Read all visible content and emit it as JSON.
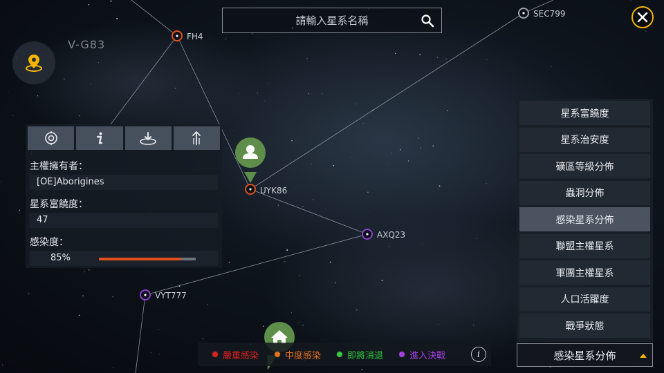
{
  "system": {
    "current_name": "V-G83"
  },
  "search": {
    "placeholder": "請輸入星系名稱"
  },
  "nodes": [
    {
      "id": "FH4",
      "label": "FH4",
      "color": "#e2501c"
    },
    {
      "id": "SEC799",
      "label": "SEC799",
      "color": "#9aa3ad"
    },
    {
      "id": "UYK86",
      "label": "UYK86",
      "color": "#e2501c"
    },
    {
      "id": "AXQ23",
      "label": "AXQ23",
      "color": "#8e3fd0"
    },
    {
      "id": "VYT777",
      "label": "VYT777",
      "color": "#8e3fd0"
    }
  ],
  "info_panel": {
    "owner_label": "主權擁有者：",
    "owner_value": "[OE]Aborigines",
    "richness_label": "星系富饒度：",
    "richness_value": "47",
    "infection_label": "感染度：",
    "infection_value": "85%",
    "infection_fraction": 0.85,
    "tab_icons": [
      "target-icon",
      "info-icon",
      "warp-icon",
      "upload-icon"
    ]
  },
  "legend": {
    "items": [
      {
        "label": "嚴重感染",
        "color": "#e02020"
      },
      {
        "label": "中度感染",
        "color": "#e2701c"
      },
      {
        "label": "即將消退",
        "color": "#2ecc40"
      },
      {
        "label": "進入決戰",
        "color": "#a040e0"
      }
    ],
    "info_glyph": "i"
  },
  "filter_menu": {
    "items": [
      {
        "label": "星系富饒度"
      },
      {
        "label": "星系治安度"
      },
      {
        "label": "礦區等級分佈"
      },
      {
        "label": "蟲洞分佈"
      },
      {
        "label": "感染星系分佈",
        "selected": true
      },
      {
        "label": "聯盟主權星系"
      },
      {
        "label": "軍團主權星系"
      },
      {
        "label": "人口活躍度"
      },
      {
        "label": "戰爭狀態"
      }
    ],
    "selected_label": "感染星系分佈"
  },
  "colors": {
    "accent": "#f4b400",
    "marker_green": "#5e8e4a",
    "infection_bar": "#e2501c"
  }
}
